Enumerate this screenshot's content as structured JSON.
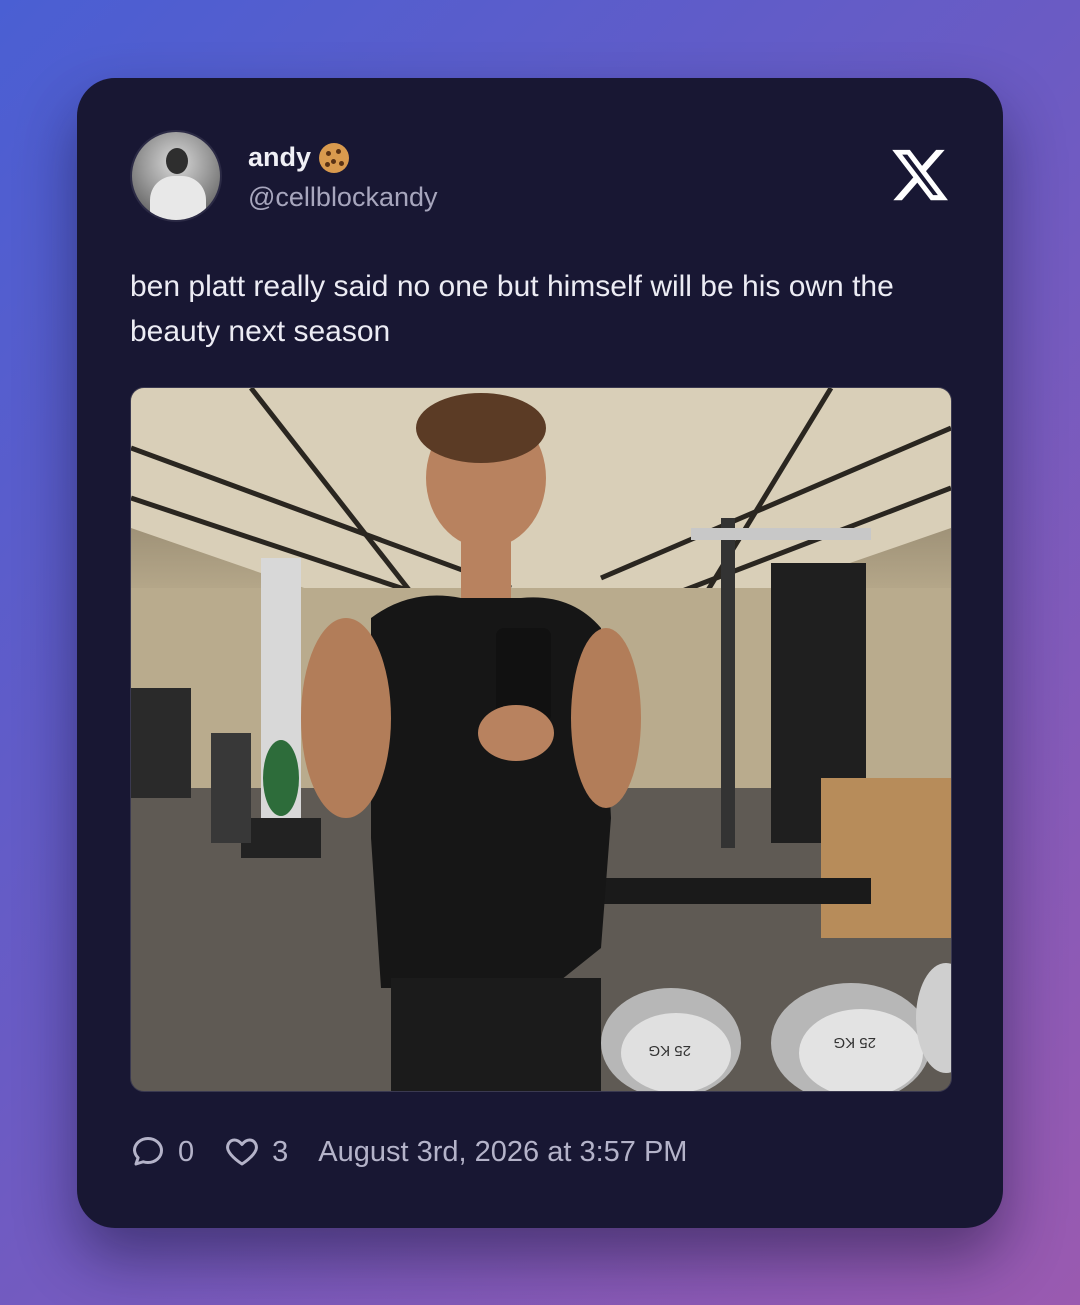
{
  "tweet": {
    "author": {
      "display_name": "andy",
      "emoji_icon": "cookie-icon",
      "handle": "@cellblockandy"
    },
    "platform_icon": "x-logo-icon",
    "text": "ben platt really said no one but himself will be his own the beauty next season",
    "media": {
      "plate_label": "25 KG"
    },
    "stats": {
      "replies": "0",
      "likes": "3"
    },
    "timestamp": "August 3rd, 2026 at 3:57 PM"
  },
  "colors": {
    "card_bg": "#181733",
    "text_primary": "#ececf4",
    "text_secondary": "#a7a6bd"
  }
}
